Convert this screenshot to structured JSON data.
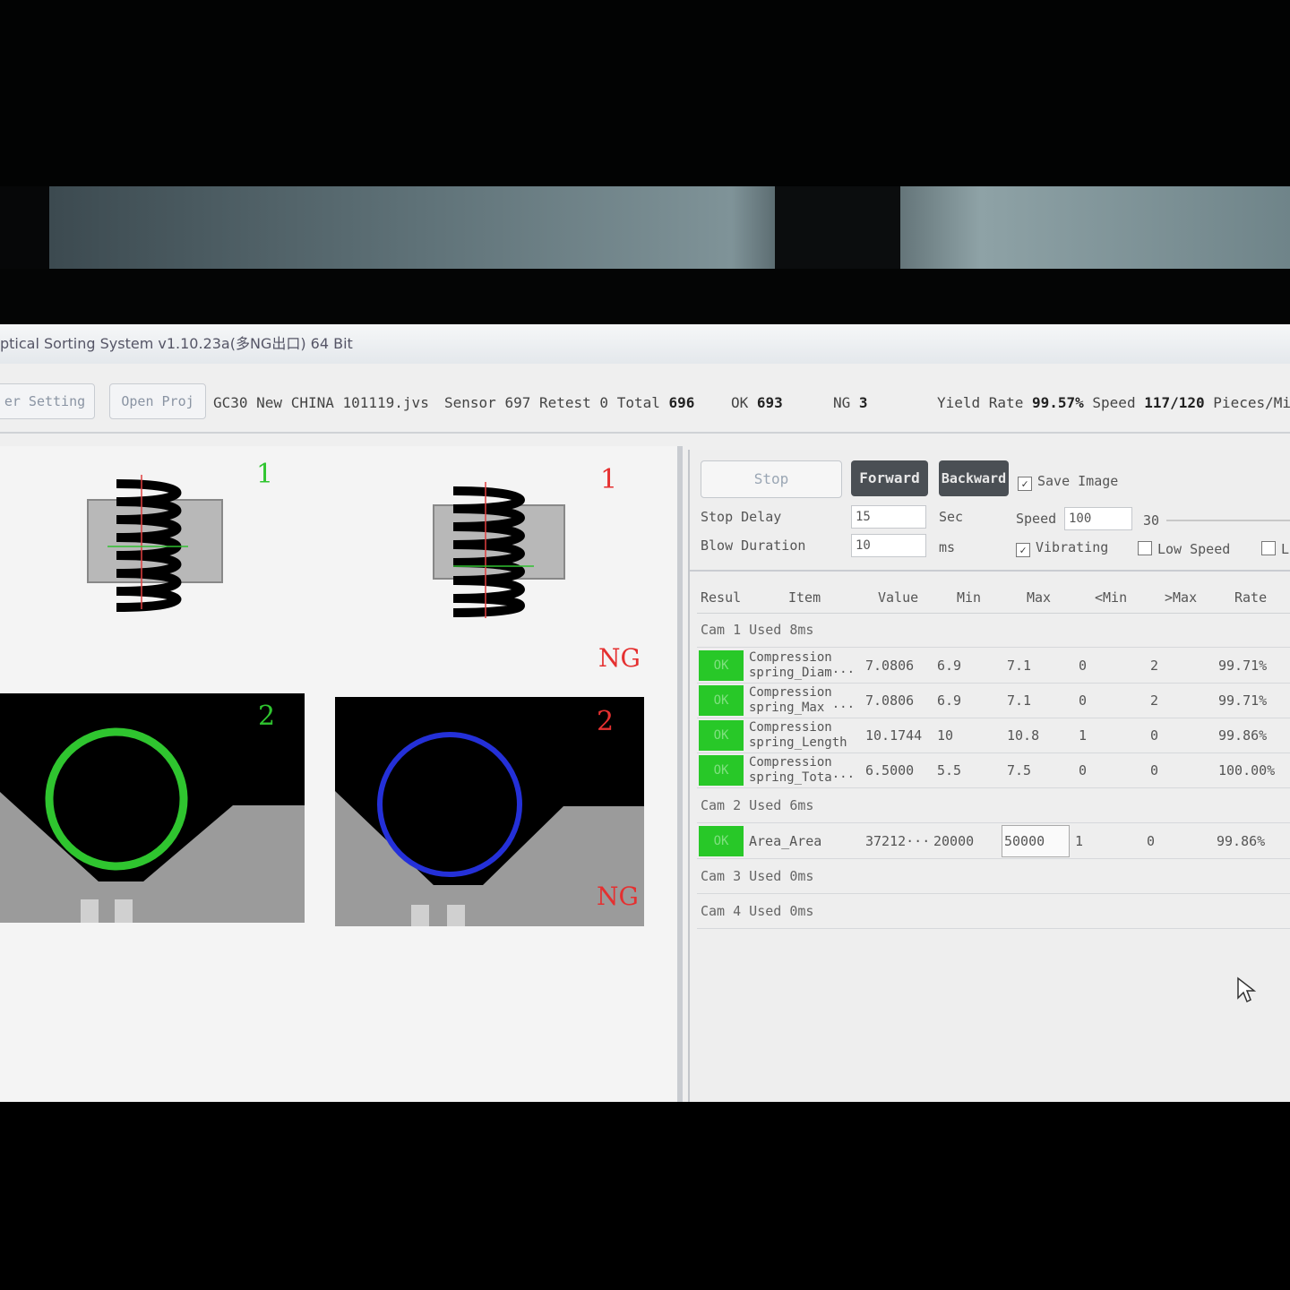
{
  "window": {
    "title": "ptical Sorting System v1.10.23a(多NG出口) 64 Bit"
  },
  "toolbar": {
    "setting_btn": "er Setting",
    "open_proj_btn": "Open Proj",
    "project_file": "GC30 New CHINA 101119.jvs",
    "sensor_label": "Sensor",
    "sensor_value": "697",
    "retest_label": "Retest",
    "retest_value": "0",
    "total_label": "Total",
    "total_value": "696",
    "ok_label": "OK",
    "ok_value": "693",
    "ng_label": "NG",
    "ng_value": "3",
    "yield_label": "Yield Rate",
    "yield_value": "99.57%",
    "speed_label": "Speed",
    "speed_value": "117/120",
    "speed_unit": "Pieces/Mi"
  },
  "images": {
    "cam1_left_num": "1",
    "cam1_right_num": "1",
    "cam1_right_status": "NG",
    "cam2_left_num": "2",
    "cam2_right_num": "2",
    "cam2_right_status": "NG",
    "colors": {
      "ok_green": "#2fc52f",
      "ng_red": "#e53030",
      "circle_blue": "#2430d8"
    }
  },
  "controls": {
    "stop_btn": "Stop",
    "forward_btn": "Forward",
    "backward_btn": "Backward",
    "save_image_label": "Save Image",
    "save_image_checked": true,
    "stop_delay_label": "Stop Delay",
    "stop_delay_value": "15",
    "stop_delay_unit": "Sec",
    "blow_duration_label": "Blow Duration",
    "blow_duration_value": "10",
    "blow_duration_unit": "ms",
    "speed_label": "Speed",
    "speed_value": "100",
    "speed_extra": "30",
    "vibrating_label": "Vibrating",
    "vibrating_checked": true,
    "low_speed_label": "Low Speed",
    "low_speed_checked": false,
    "extra_check_label": "L"
  },
  "results": {
    "headers": [
      "Resul",
      "Item",
      "Value",
      "Min",
      "Max",
      "<Min",
      ">Max",
      "Rate"
    ],
    "cam1_label": "Cam 1 Used 8ms",
    "cam1_rows": [
      {
        "result": "OK",
        "item": "Compression spring_Diam···",
        "value": "7.0806",
        "min": "6.9",
        "max": "7.1",
        "lt_min": "0",
        "gt_max": "2",
        "rate": "99.71%"
      },
      {
        "result": "OK",
        "item": "Compression spring_Max ···",
        "value": "7.0806",
        "min": "6.9",
        "max": "7.1",
        "lt_min": "0",
        "gt_max": "2",
        "rate": "99.71%"
      },
      {
        "result": "OK",
        "item": "Compression spring_Length",
        "value": "10.1744",
        "min": "10",
        "max": "10.8",
        "lt_min": "1",
        "gt_max": "0",
        "rate": "99.86%"
      },
      {
        "result": "OK",
        "item": "Compression spring_Tota···",
        "value": "6.5000",
        "min": "5.5",
        "max": "7.5",
        "lt_min": "0",
        "gt_max": "0",
        "rate": "100.00%"
      }
    ],
    "cam2_label": "Cam 2 Used 6ms",
    "cam2_rows": [
      {
        "result": "OK",
        "item": "Area_Area",
        "value": "37212···",
        "min": "20000",
        "max": "50000",
        "lt_min": "1",
        "gt_max": "0",
        "rate": "99.86%"
      }
    ],
    "cam3_label": "Cam 3 Used 0ms",
    "cam4_label": "Cam 4 Used 0ms"
  }
}
